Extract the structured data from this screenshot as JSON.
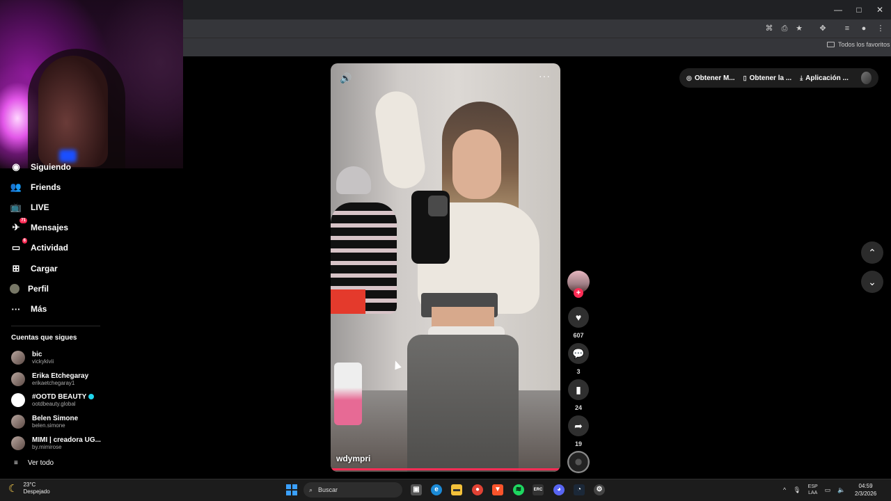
{
  "browser": {
    "window_controls": [
      "—",
      "□",
      "✕"
    ],
    "bookmarks_folder": "Todos los favoritos"
  },
  "sidebar": {
    "items": [
      {
        "label": "Siguiendo",
        "icon": "following-icon"
      },
      {
        "label": "Friends",
        "icon": "friends-icon"
      },
      {
        "label": "LIVE",
        "icon": "live-icon"
      },
      {
        "label": "Mensajes",
        "icon": "messages-icon",
        "badge": "71"
      },
      {
        "label": "Actividad",
        "icon": "activity-icon",
        "badge": "6"
      },
      {
        "label": "Cargar",
        "icon": "upload-icon"
      },
      {
        "label": "Perfil",
        "icon": "profile-icon"
      },
      {
        "label": "Más",
        "icon": "more-icon"
      }
    ],
    "following_title": "Cuentas que sigues",
    "accounts": [
      {
        "name": "bic",
        "username": "vickykivii"
      },
      {
        "name": "Erika Etchegaray",
        "username": "erikaetchegaray1"
      },
      {
        "name": "#OOTD BEAUTY",
        "username": "ootdbeauty.global",
        "verified": true
      },
      {
        "name": "Belen Simone",
        "username": "belen.simone"
      },
      {
        "name": "MIMI | creadora UG...",
        "username": "by.mimirose"
      }
    ],
    "see_all": "Ver todo"
  },
  "video": {
    "author": "wdympri",
    "progress": 1.0
  },
  "actions": {
    "likes": "607",
    "comments": "3",
    "saves": "24",
    "shares": "19"
  },
  "top_pill": {
    "coins": "Obtener M...",
    "app": "Obtener la ...",
    "download": "Aplicación ..."
  },
  "taskbar": {
    "temperature": "23°C",
    "weather": "Despejado",
    "search_placeholder": "Buscar",
    "lang1": "ESP",
    "lang2": "LAA",
    "time": "04:59",
    "date": "2/3/2026"
  },
  "colors": {
    "accent": "#fe2c55",
    "background": "#000000"
  }
}
